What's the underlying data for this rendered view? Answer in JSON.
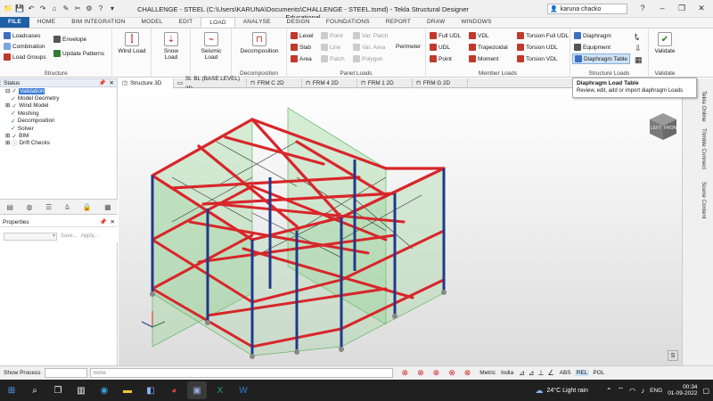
{
  "title_bar": {
    "window_title": "CHALLENGE - STEEL (C:\\Users\\KARUNA\\Documents\\CHALLENGE - STEEL.tsmd) - Tekla Structural Designer Educational",
    "user_name": "karuna chacko",
    "qat_icons": [
      "folder-icon",
      "save-icon",
      "undo-icon",
      "redo-icon",
      "structure-icon",
      "marker-icon",
      "scissors-icon",
      "gear-icon",
      "help-icon",
      "dropdown-icon"
    ]
  },
  "ribbon_tabs": [
    "FILE",
    "HOME",
    "BIM INTEGRATION",
    "MODEL",
    "EDIT",
    "LOAD",
    "ANALYSE",
    "DESIGN",
    "FOUNDATIONS",
    "REPORT",
    "DRAW",
    "WINDOWS"
  ],
  "active_tab": "LOAD",
  "ribbon": {
    "structure": {
      "label": "Structure",
      "items": [
        "Loadcases",
        "Combination",
        "Load Groups",
        "Envelope",
        "Update Patterns"
      ]
    },
    "wind": {
      "label": "Wind Load"
    },
    "snow": {
      "label": "Snow Load"
    },
    "seismic": {
      "label": "Seismic Load"
    },
    "decomposition": {
      "label": "Decomposition",
      "group": "Decomposition"
    },
    "panel_loads": {
      "label": "Panel Loads",
      "items": [
        "Level",
        "Slab",
        "Area",
        "Point",
        "Line",
        "Patch",
        "Var. Patch",
        "Var. Area",
        "Polygon",
        "Perimeter"
      ]
    },
    "member_loads": {
      "label": "Member Loads",
      "items": [
        "Full UDL",
        "UDL",
        "Point",
        "VDL",
        "Trapezoidal",
        "Moment",
        "Torsion Full UDL",
        "Torsion UDL",
        "Torsion VDL"
      ]
    },
    "structure_loads": {
      "label": "Structure Loads",
      "items": [
        "Diaphragm",
        "Equipment",
        "Diaphragm Table"
      ]
    },
    "validate": {
      "label": "Validate",
      "group": "Validate"
    }
  },
  "tooltip": {
    "title": "Diaphragm Load Table",
    "description": "Review, edit, add or import diaphragm Loads"
  },
  "status_panel": {
    "header": "Status",
    "items": [
      {
        "label": "Validation",
        "selected": true
      },
      {
        "label": "Model Geometry"
      },
      {
        "label": "Wind Model"
      },
      {
        "label": "Meshing"
      },
      {
        "label": "Decomposition"
      },
      {
        "label": "Solver"
      },
      {
        "label": "BIM"
      },
      {
        "label": "Drift Checks"
      }
    ]
  },
  "properties_panel": {
    "header": "Properties",
    "save_label": "Save...",
    "apply_label": "Apply..."
  },
  "view_tabs": [
    "Structure 3D",
    "St. BL (BASE LEVEL) 2D",
    "FRM C 2D",
    "FRM 4 2D",
    "FRM 1 2D",
    "FRM G 2D"
  ],
  "right_side_tabs": [
    "Tekla Online",
    "Trimble Connect",
    "Scene Content"
  ],
  "view_cube": {
    "left": "LEFT",
    "front": "FRONT"
  },
  "status_bar": {
    "show_process": "Show Process",
    "none_placeholder": "none",
    "metric": "Metric",
    "region": "India",
    "abs": "ABS",
    "rel": "REL",
    "pol": "POL"
  },
  "taskbar": {
    "weather": "24°C  Light rain",
    "lang": "ENG",
    "time": "00:34",
    "date": "01-09-2022"
  },
  "colors": {
    "beam": "#d8262a",
    "column": "#1f3a8a",
    "panel": "#8fd08f",
    "accent": "#1f5fa8"
  }
}
